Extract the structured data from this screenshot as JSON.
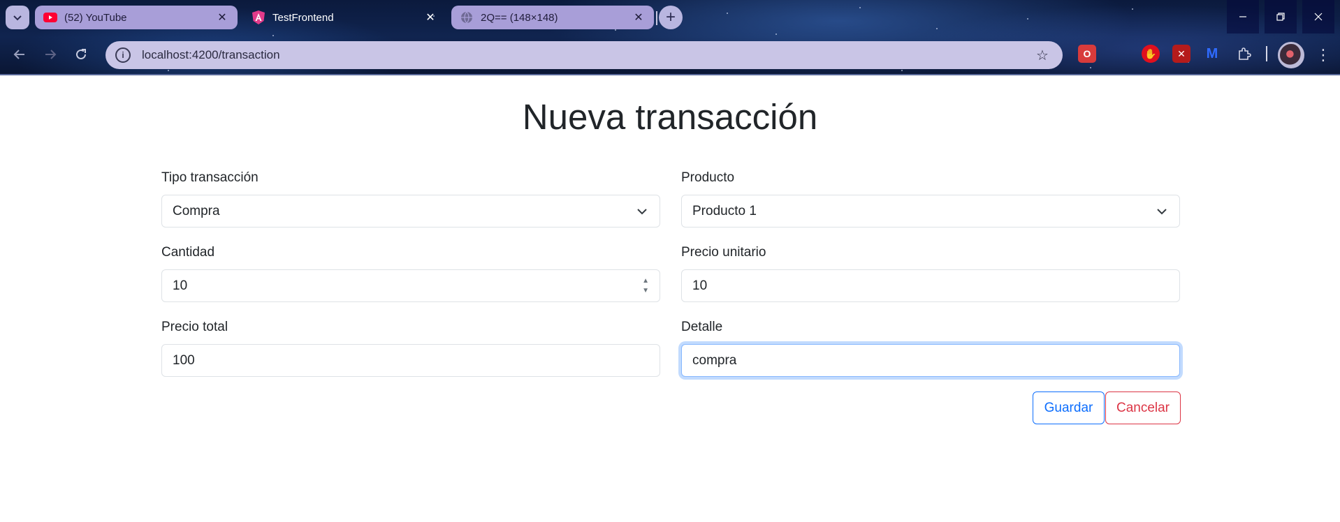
{
  "browser": {
    "tabs": [
      {
        "title": "(52) YouTube",
        "icon": "youtube-icon",
        "active": false
      },
      {
        "title": "TestFrontend",
        "icon": "angular-icon",
        "active": true
      },
      {
        "title": "2Q== (148×148)",
        "icon": "globe-icon",
        "active": false
      }
    ],
    "url": "localhost:4200/transaction",
    "extensions": [
      "office-icon",
      "adblock-icon",
      "ublock-icon",
      "malwarebytes-icon",
      "extensions-puzzle-icon"
    ]
  },
  "page": {
    "title": "Nueva transacción",
    "form": {
      "tipo": {
        "label": "Tipo transacción",
        "value": "Compra"
      },
      "producto": {
        "label": "Producto",
        "value": "Producto 1"
      },
      "cantidad": {
        "label": "Cantidad",
        "value": "10"
      },
      "precio_unitario": {
        "label": "Precio unitario",
        "value": "10"
      },
      "precio_total": {
        "label": "Precio total",
        "value": "100"
      },
      "detalle": {
        "label": "Detalle",
        "value": "compra"
      }
    },
    "buttons": {
      "save": "Guardar",
      "cancel": "Cancelar"
    }
  },
  "colors": {
    "primary": "#0d6efd",
    "danger": "#dc3545",
    "focus_ring": "#86b7fe"
  }
}
